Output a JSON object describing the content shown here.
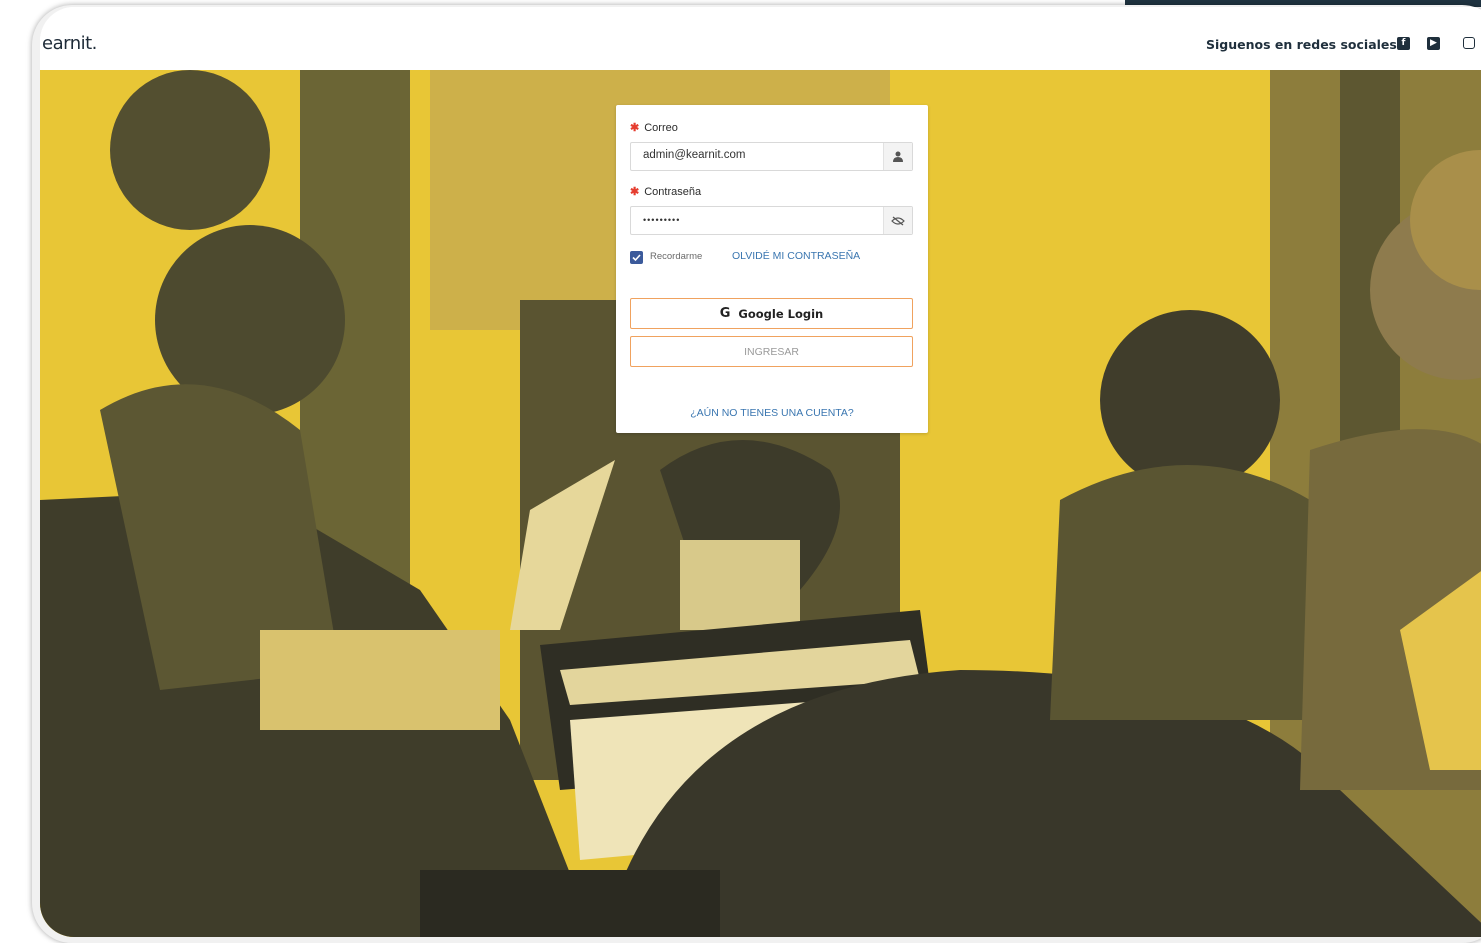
{
  "app": {
    "logo": "earnit.",
    "social_text": "Siguenos en redes sociales",
    "social_icons": [
      "facebook-icon",
      "youtube-icon",
      "instagram-icon"
    ]
  },
  "form": {
    "email_label": "Correo",
    "email_value": "admin@kearnit.com",
    "password_label": "Contraseña",
    "password_value": "•••••••••",
    "remember_label": "Recordarme",
    "remember_checked": true,
    "forgot_link": "OLVIDÉ MI CONTRASEÑA",
    "google_button": "Google Login",
    "google_icon": "G",
    "submit_button": "INGRESAR",
    "signup_link": "¿AÚN NO TIENES UNA CUENTA?"
  },
  "colors": {
    "accent_blue": "#3a76b0",
    "required_red": "#e53d2f",
    "button_border": "#f0a25e",
    "background_yellow": "#e8c636",
    "checkbox_blue": "#3b5a9b"
  }
}
